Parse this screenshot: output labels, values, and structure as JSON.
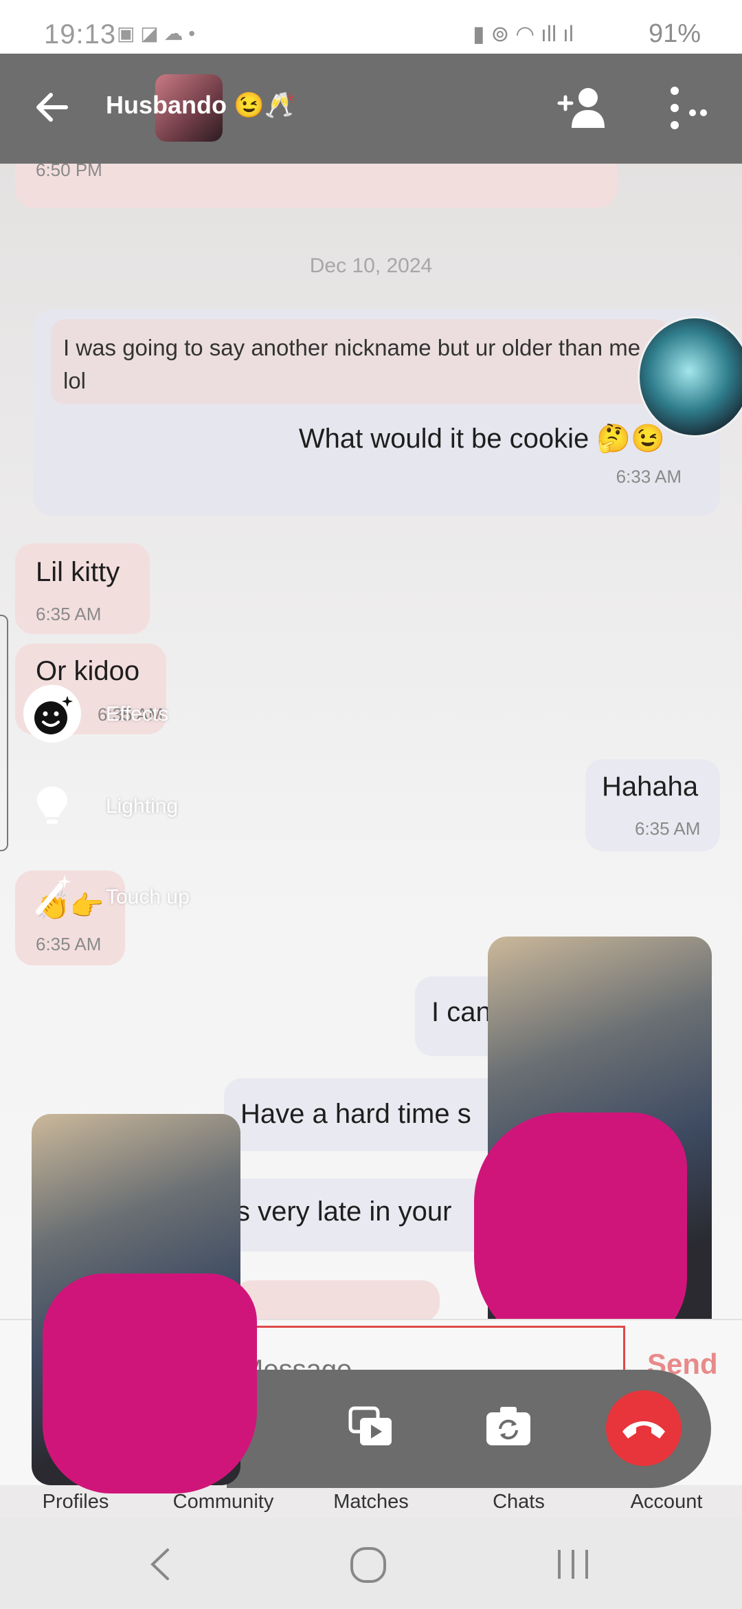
{
  "status_bar": {
    "time": "19:13",
    "battery": "91%"
  },
  "header": {
    "title": "Husbando 😉🥂"
  },
  "chat": {
    "prev_timestamp": "6:50 PM",
    "date_separator": "Dec 10, 2024",
    "quoted_message": "I was going to say another nickname but ur older than me lol",
    "reply_message": "What would it be cookie 🤔😉",
    "reply_time": "6:33 AM",
    "messages": [
      {
        "text": "Lil kitty",
        "time": "6:35 AM",
        "side": "in"
      },
      {
        "text": "Or kidoo",
        "time": "6:35 AM",
        "side": "in"
      },
      {
        "text": "Hahaha",
        "time": "6:35 AM",
        "side": "out"
      },
      {
        "text": "👏👉",
        "time": "6:35 AM",
        "side": "in"
      },
      {
        "text": "I can't",
        "side": "out"
      },
      {
        "text": "Have a hard time s",
        "side": "out"
      },
      {
        "text": "s very late in your",
        "side": "out"
      }
    ]
  },
  "effects_menu": {
    "items": [
      {
        "label": "Effects",
        "icon": "smiley-sparkle-icon"
      },
      {
        "label": "Lighting",
        "icon": "bulb-icon"
      },
      {
        "label": "Touch up",
        "icon": "wand-icon"
      }
    ]
  },
  "input": {
    "placeholder": "Message",
    "send_label": "Send"
  },
  "bottom_nav": {
    "items": [
      "Profiles",
      "Community",
      "Matches",
      "Chats",
      "Account"
    ]
  },
  "colors": {
    "header": "#6e6e6e",
    "incoming_bubble": "#f3dede",
    "outgoing_bubble": "#e9e9f1",
    "redaction": "#d0157a",
    "end_call": "#e8343b",
    "send": "#e88a8a"
  }
}
